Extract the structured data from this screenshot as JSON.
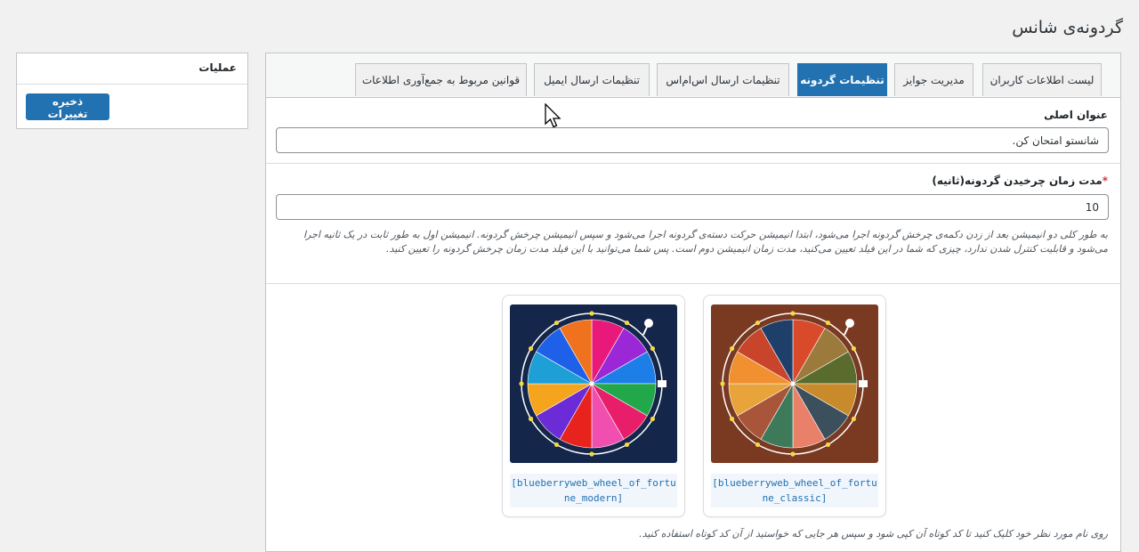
{
  "page": {
    "title": "گردونه‌ی شانس"
  },
  "side_box": {
    "title": "عملیات",
    "save_label": "ذخیره تغییرات"
  },
  "tabs": [
    {
      "label": "لیست اطلاعات کاربران",
      "active": false
    },
    {
      "label": "مدیریت جوایز",
      "active": false
    },
    {
      "label": "تنظیمات گردونه",
      "active": true
    },
    {
      "label": "تنظیمات ارسال اس‌ام‌اس",
      "active": false
    },
    {
      "label": "تنظیمات ارسال ایمیل",
      "active": false
    },
    {
      "label": "قوانین مربوط به جمع‌آوری اطلاعات",
      "active": false
    }
  ],
  "form": {
    "main_title": {
      "label": "عنوان اصلی",
      "value": "شانستو امتحان کن."
    },
    "duration": {
      "label": "مدت زمان چرخیدن گردونه(ثانیه)",
      "required_mark": "*",
      "value": "10",
      "help": "به طور کلی دو انیمیشن بعد از زدن دکمه‌ی چرخش گردونه اجرا می‌شود، ابتدا انیمیشن حرکت دسته‌ی گردونه اجرا می‌شود و سپس انیمیشن چرخش گردونه. انیمیشن اول به طور ثابت در یک ثانیه اجرا می‌شود و قابلیت کنترل شدن ندارد، چیزی که شما در این فیلد تعیین می‌کنید، مدت زمان انیمیشن دوم است. پس شما می‌توانید با این فیلد مدت زمان چرخش گردونه را تعیین کنید."
    }
  },
  "templates": [
    {
      "shortcode": "[blueberryweb_wheel_of_fortune_classic]",
      "style": "classic"
    },
    {
      "shortcode": "[blueberryweb_wheel_of_fortune_modern]",
      "style": "modern"
    }
  ],
  "footnote": "روی نام مورد نظر خود کلیک کنید تا کد کوتاه آن کپی شود و سپس هر جایی که خواستید از آن کد کوتاه استفاده کنید.",
  "colors": {
    "accent": "#2271b1",
    "classic_bg": "#7a3a22",
    "modern_bg": "#14264a",
    "classic_segments": [
      "#d94a2b",
      "#9c7a3c",
      "#5a6b2e",
      "#c98a2c",
      "#3b4f5c",
      "#e8806a",
      "#3e7a5a",
      "#a8553a",
      "#e8a33a",
      "#f09030",
      "#c8442a",
      "#1e3f6a"
    ],
    "modern_segments": [
      "#e8197a",
      "#9b27d6",
      "#1e7ee8",
      "#22a84a",
      "#e81e6a",
      "#f04fb0",
      "#e8231e",
      "#6b2bd6",
      "#f5a41e",
      "#1e9fd6",
      "#1e60e8",
      "#f0721e"
    ]
  }
}
